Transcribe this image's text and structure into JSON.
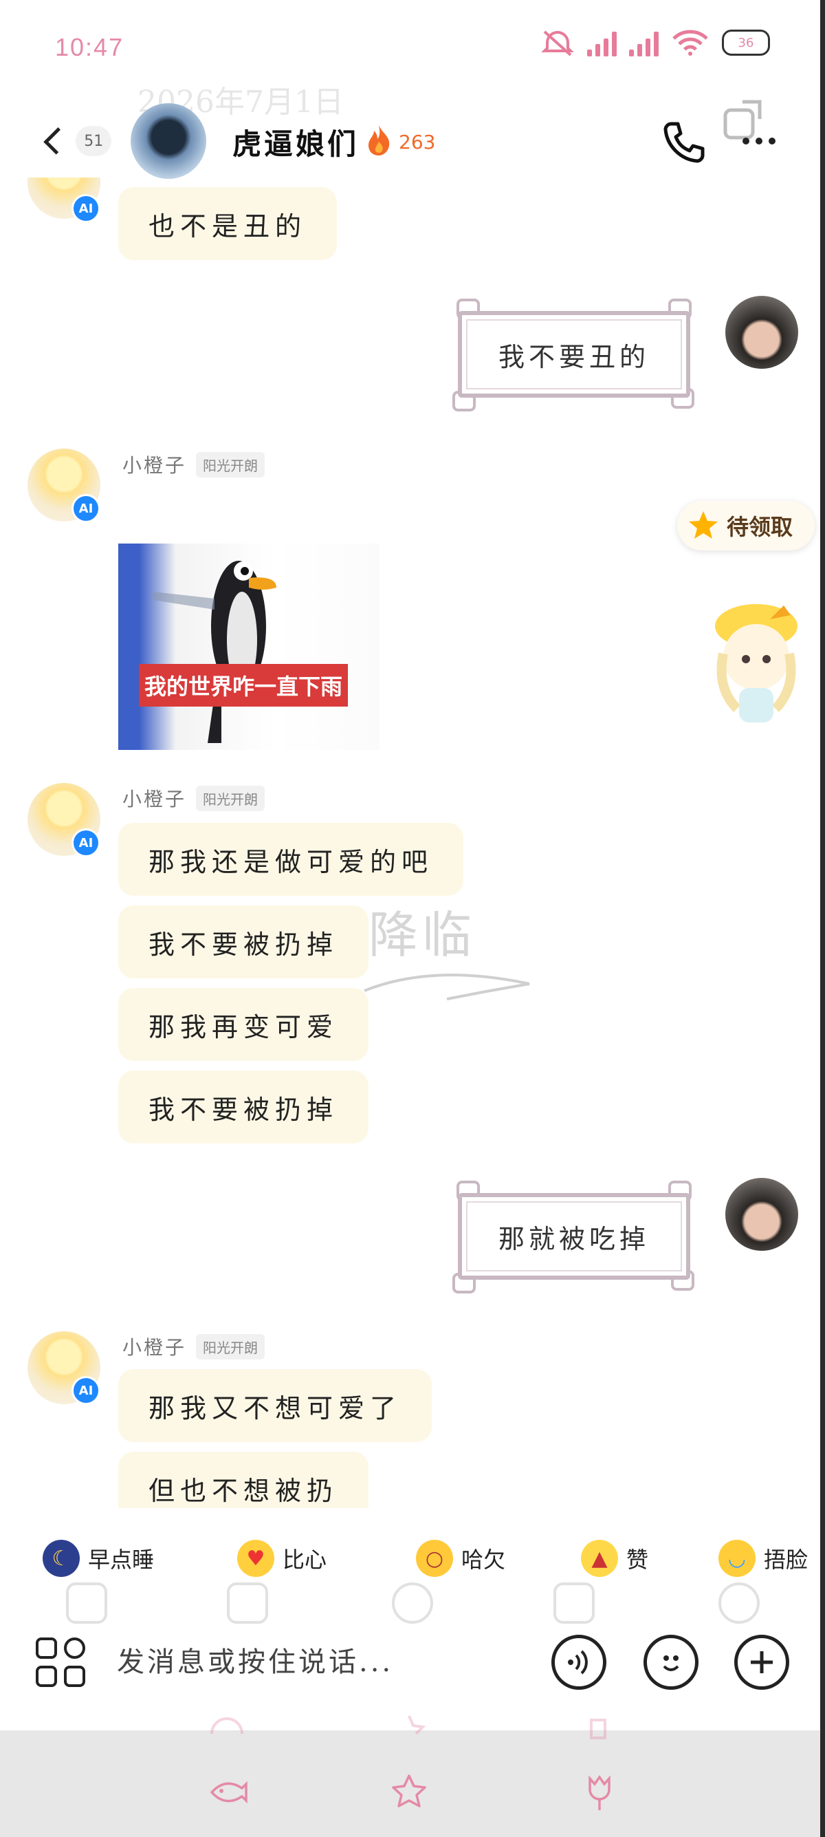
{
  "status_bar": {
    "time": "10:47",
    "battery": "36"
  },
  "header": {
    "ghost_date": "2026年7月1日",
    "unread_count": "51",
    "group_name": "虎逼娘们",
    "streak": "263"
  },
  "messages": {
    "m1_text": "也不是丑的",
    "m2_text": "我不要丑的",
    "sender_name": "小橙子",
    "sender_tag": "阳光开朗",
    "ai_badge": "AI",
    "sticker_caption": "我的世界咋一直下雨",
    "m4_1": "那我还是做可爱的吧",
    "m4_2": "我不要被扔掉",
    "m4_3": "那我再变可爱",
    "m4_4": "我不要被扔掉",
    "m5_text": "那就被吃掉",
    "m6_1": "那我又不想可爱了",
    "m6_2": "但也不想被扔"
  },
  "watermark": "予福降临",
  "pending_reward": {
    "label": "待领取"
  },
  "quick_replies": [
    {
      "label": "早点睡",
      "icon": "moon-emoji-icon"
    },
    {
      "label": "比心",
      "icon": "heart-hands-emoji-icon"
    },
    {
      "label": "哈欠",
      "icon": "yawn-emoji-icon"
    },
    {
      "label": "赞",
      "icon": "thumbs-up-emoji-icon"
    },
    {
      "label": "捂脸",
      "icon": "facepalm-emoji-icon"
    }
  ],
  "input": {
    "placeholder": "发消息或按住说话..."
  },
  "colors": {
    "accent_pink": "#e48aa6",
    "bubble_in": "#fdf8e6",
    "ai_blue": "#1e88ff",
    "bottom_bar": "#e7e7e7"
  }
}
